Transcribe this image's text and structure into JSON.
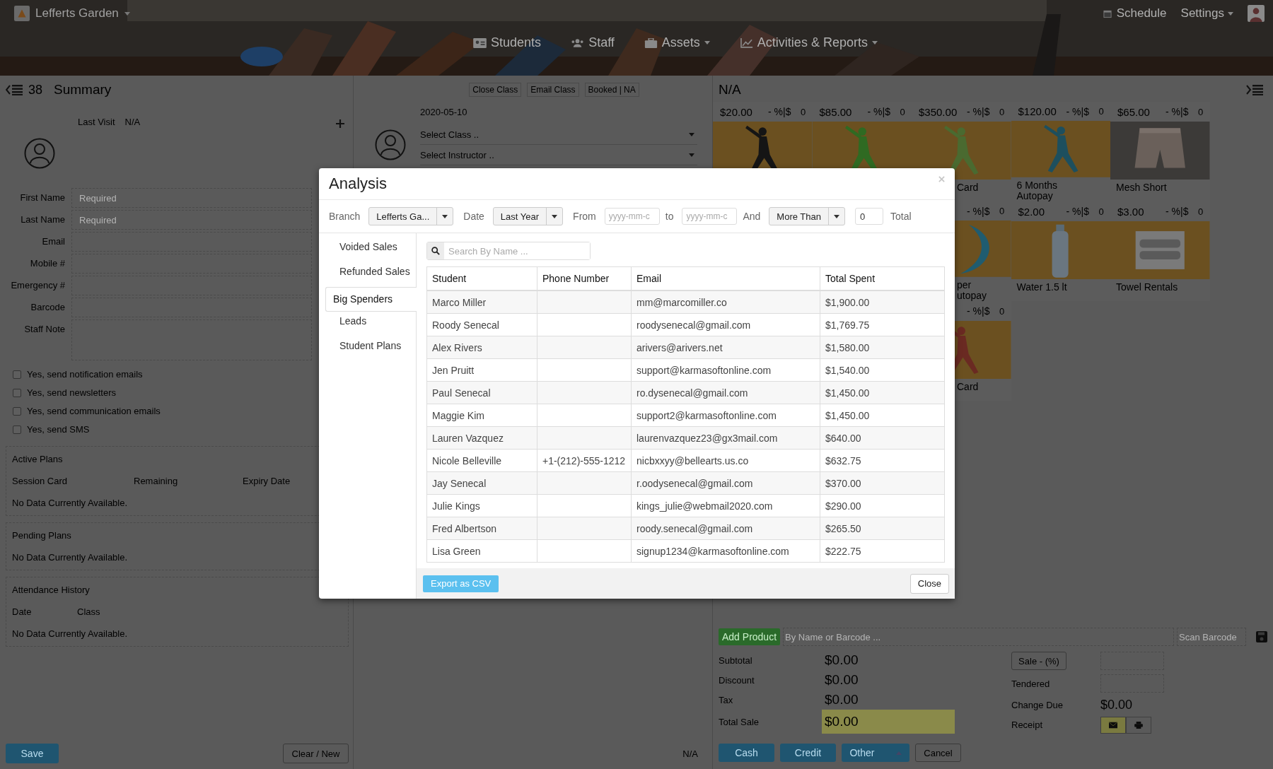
{
  "header": {
    "branch": "Lefferts Garden",
    "links": [
      {
        "label": "Schedule",
        "dropdown": false
      },
      {
        "label": "Settings",
        "dropdown": true
      }
    ],
    "nav": [
      {
        "label": "Students",
        "dropdown": false
      },
      {
        "label": "Staff",
        "dropdown": false
      },
      {
        "label": "Assets",
        "dropdown": true
      },
      {
        "label": "Activities & Reports",
        "dropdown": true
      }
    ]
  },
  "student": {
    "count": "38",
    "title": "Summary",
    "last_visit_label": "Last Visit",
    "last_visit": "N/A",
    "fields": [
      {
        "label": "First Name",
        "placeholder": "Required",
        "kind": "input"
      },
      {
        "label": "Last Name",
        "placeholder": "Required",
        "kind": "input"
      },
      {
        "label": "Email",
        "kind": "input"
      },
      {
        "label": "Mobile #",
        "kind": "input"
      },
      {
        "label": "Emergency #",
        "kind": "input"
      },
      {
        "label": "Barcode",
        "kind": "input"
      },
      {
        "label": "Staff Note",
        "kind": "textarea"
      }
    ],
    "checkboxes": [
      {
        "label": "Yes, send notification emails",
        "checked": false
      },
      {
        "label": "Yes, send newsletters",
        "checked": false
      },
      {
        "label": "Yes, send communication emails",
        "checked": false
      },
      {
        "label": "Yes, send SMS",
        "checked": false
      }
    ],
    "sections": [
      {
        "title": "Active Plans",
        "columns": [
          "Session Card",
          "Remaining",
          "Expiry Date"
        ],
        "empty": "No Data Currently Available."
      },
      {
        "title": "Pending Plans",
        "empty": "No Data Currently Available."
      },
      {
        "title": "Attendance History",
        "columns": [
          "Date",
          "Class"
        ],
        "empty": "No Data Currently Available."
      }
    ],
    "save": "Save",
    "clear": "Clear / New"
  },
  "class_panel": {
    "actions": [
      "Close Class",
      "Email Class",
      "Booked | NA"
    ],
    "date": "2020-05-10",
    "selects": [
      "Select Class ..",
      "Select Instructor .."
    ],
    "footer": "N/A"
  },
  "sales": {
    "title": "N/A",
    "product_rows": [
      [
        {
          "price": "$20.00",
          "discount": "- %|$",
          "qty": "0"
        },
        {
          "price": "$85.00",
          "discount": "- %|$",
          "qty": "0"
        },
        {
          "price": "$350.00",
          "discount": "- %|$",
          "qty": "0",
          "label": [
            "Card"
          ]
        },
        {
          "price": "$120.00",
          "discount": "- %|$",
          "qty": "0",
          "label": [
            "6 Months",
            "Autopay"
          ]
        },
        {
          "price": "$65.00",
          "discount": "- %|$",
          "qty": "0",
          "label": [
            "Mesh Short"
          ]
        }
      ],
      [
        {
          "discount": "- %|$",
          "qty": "0",
          "label": [
            "per",
            "utopay"
          ]
        },
        {
          "price": "$2.00",
          "discount": "- %|$",
          "qty": "0",
          "label": [
            "Water 1.5 lt"
          ]
        },
        {
          "price": "$3.00",
          "discount": "- %|$",
          "qty": "0",
          "label": [
            "Towel Rentals"
          ]
        }
      ],
      [
        {
          "discount": "- %|$",
          "qty": "0",
          "label": [
            "Card"
          ]
        }
      ]
    ],
    "add_product": "Add Product",
    "search_placeholder": "By Name or Barcode ...",
    "scan_placeholder": "Scan Barcode",
    "totals": [
      {
        "label": "Subtotal",
        "value": "$0.00",
        "highlight": false
      },
      {
        "label": "Discount",
        "value": "$0.00",
        "highlight": false
      },
      {
        "label": "Tax",
        "value": "$0.00",
        "highlight": false
      },
      {
        "label": "Total Sale",
        "value": "$0.00",
        "highlight": true
      }
    ],
    "sale_button": "Sale - (%)",
    "tendered_label": "Tendered",
    "change_label": "Change Due",
    "change": "$0.00",
    "receipt_label": "Receipt",
    "pay_buttons": [
      {
        "label": "Cash",
        "dropdown": false
      },
      {
        "label": "Credit",
        "dropdown": false
      },
      {
        "label": "Other",
        "dropdown": true
      }
    ],
    "cancel": "Cancel"
  },
  "modal": {
    "title": "Analysis",
    "filters": [
      {
        "kind": "label",
        "text": "Branch"
      },
      {
        "kind": "select",
        "value": "Lefferts Ga..."
      },
      {
        "kind": "label",
        "text": "Date"
      },
      {
        "kind": "select",
        "value": "Last Year"
      },
      {
        "kind": "label",
        "text": "From"
      },
      {
        "kind": "date",
        "placeholder": "yyyy-mm-c"
      },
      {
        "kind": "label",
        "text": "to"
      },
      {
        "kind": "date",
        "placeholder": "yyyy-mm-c"
      },
      {
        "kind": "label",
        "text": "And"
      },
      {
        "kind": "select",
        "value": "More Than"
      },
      {
        "kind": "number",
        "value": "0"
      },
      {
        "kind": "label",
        "text": "Total"
      }
    ],
    "tabs": [
      {
        "label": "Voided Sales",
        "selected": false
      },
      {
        "label": "Refunded Sales",
        "selected": false
      },
      {
        "label": "Big Spenders",
        "selected": true
      },
      {
        "label": "Leads",
        "selected": false
      },
      {
        "label": "Student Plans",
        "selected": false
      }
    ],
    "search_placeholder": "Search By Name ...",
    "columns": [
      "Student",
      "Phone Number",
      "Email",
      "Total Spent"
    ],
    "rows": [
      [
        "Marco Miller",
        "",
        "mm@marcomiller.co",
        "$1,900.00"
      ],
      [
        "Roody Senecal",
        "",
        "roodysenecal@gmail.com",
        "$1,769.75"
      ],
      [
        "Alex Rivers",
        "",
        "arivers@arivers.net",
        "$1,580.00"
      ],
      [
        "Jen Pruitt",
        "",
        "support@karmasoftonline.com",
        "$1,540.00"
      ],
      [
        "Paul Senecal",
        "",
        "ro.dysenecal@gmail.com",
        "$1,450.00"
      ],
      [
        "Maggie Kim",
        "",
        "support2@karmasoftonline.com",
        "$1,450.00"
      ],
      [
        "Lauren Vazquez",
        "",
        "laurenvazquez23@gx3mail.com",
        "$640.00"
      ],
      [
        "Nicole Belleville",
        "+1-(212)-555-1212",
        "nicbxxyy@bellearts.us.co",
        "$632.75"
      ],
      [
        "Jay Senecal",
        "",
        "r.oodysenecal@gmail.com",
        "$370.00"
      ],
      [
        "Julie Kings",
        "",
        "kings_julie@webmail2020.com",
        "$290.00"
      ],
      [
        "Fred Albertson",
        "",
        "roody.senecal@gmail.com",
        "$265.50"
      ],
      [
        "Lisa Green",
        "",
        "signup1234@karmasoftonline.com",
        "$222.75"
      ]
    ],
    "export": "Export as CSV",
    "close": "Close"
  }
}
